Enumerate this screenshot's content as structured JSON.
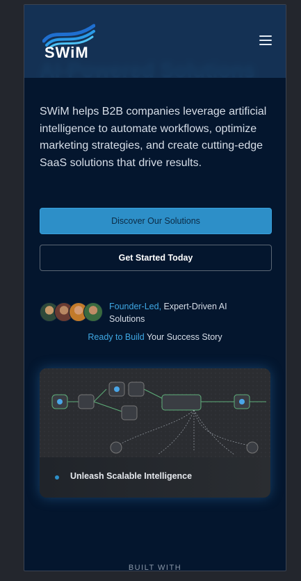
{
  "brand": {
    "name": "SWiM"
  },
  "hero": {
    "headline_partial": "AI-Powered Solutions",
    "description": "SWiM helps B2B companies leverage artificial intelligence to automate workflows, optimize marketing strategies, and create cutting-edge SaaS solutions that drive results."
  },
  "buttons": {
    "primary": "Discover Our Solutions",
    "secondary": "Get Started Today"
  },
  "founder": {
    "accent": "Founder-Led,",
    "rest": " Expert-Driven AI Solutions"
  },
  "ready": {
    "accent": "Ready to Build",
    "rest": " Your Success Story"
  },
  "card": {
    "caption": "Unleash Scalable Intelligence"
  },
  "section": {
    "built_with": "BUILT WITH"
  },
  "icons": {
    "menu": "hamburger-menu-icon",
    "logo": "wave-logo-icon"
  },
  "colors": {
    "accent": "#2d8fc8",
    "background": "#04162e"
  }
}
